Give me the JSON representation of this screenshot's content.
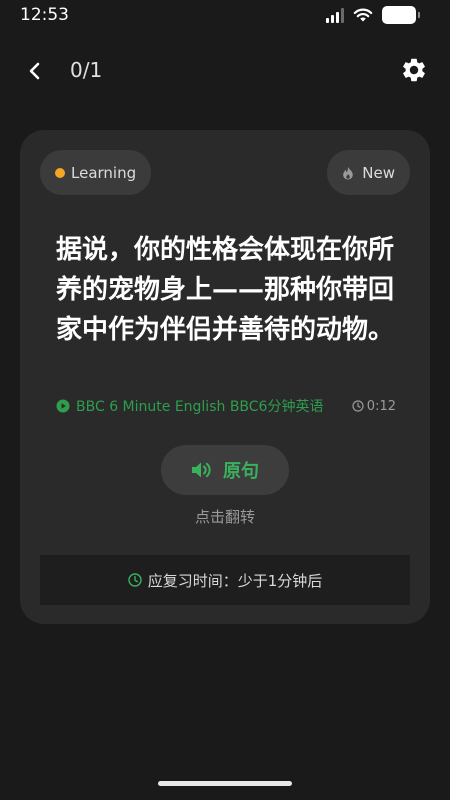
{
  "status_bar": {
    "time": "12:53"
  },
  "header": {
    "progress": "0/1"
  },
  "card": {
    "badge_learning": "Learning",
    "badge_new": "New",
    "sentence": "据说，你的性格会体现在你所养的宠物身上——那种你带回家中作为伴侣并善待的动物。",
    "source": "BBC 6 Minute English BBC6分钟英语",
    "duration": "0:12",
    "original_button": "原句",
    "flip_hint": "点击翻转",
    "review_time": "应复习时间：少于1分钟后"
  },
  "colors": {
    "accent_green": "#3ab15c",
    "learning_dot": "#f5a623",
    "card_bg": "#2a2a2a",
    "page_bg": "#1a1a1a"
  },
  "icons": [
    "back-arrow-icon",
    "gear-icon",
    "flame-icon",
    "play-circle-icon",
    "clock-icon",
    "speaker-icon"
  ]
}
